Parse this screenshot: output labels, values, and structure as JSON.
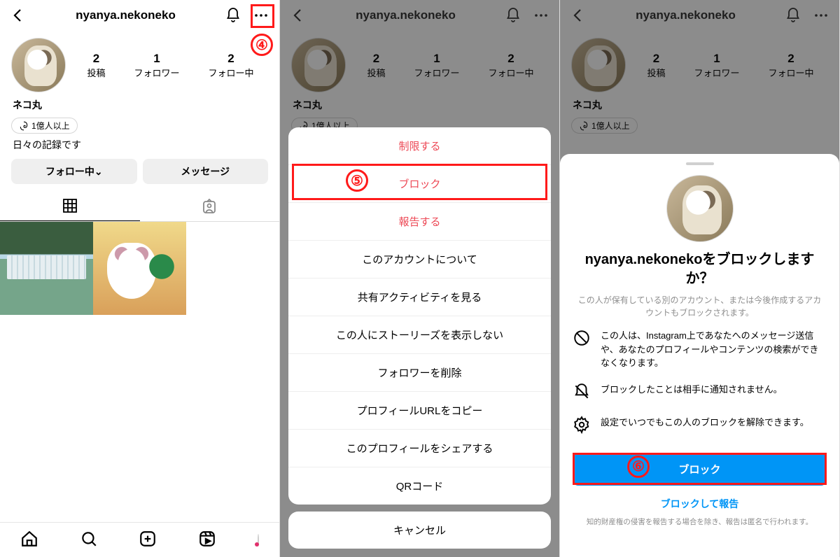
{
  "header": {
    "username": "nyanya.nekoneko"
  },
  "profile": {
    "display_name": "ネコ丸",
    "threads_followers_label": "1億人以上",
    "bio": "日々の記録です"
  },
  "stats": {
    "posts_count": "2",
    "posts_label": "投稿",
    "followers_count": "1",
    "followers_label": "フォロワー",
    "following_count": "2",
    "following_label": "フォロー中"
  },
  "buttons": {
    "following": "フォロー中",
    "message": "メッセージ"
  },
  "action_sheet": {
    "restrict": "制限する",
    "block": "ブロック",
    "report": "報告する",
    "about_account": "このアカウントについて",
    "shared_activity": "共有アクティビティを見る",
    "hide_story": "この人にストーリーズを表示しない",
    "remove_follower": "フォロワーを削除",
    "copy_url": "プロフィールURLをコピー",
    "share_profile": "このプロフィールをシェアする",
    "qr_code": "QRコード",
    "cancel": "キャンセル"
  },
  "block_confirm": {
    "title": "nyanya.nekonekoをブロックしますか？",
    "subtitle": "この人が保有している別のアカウント、または今後作成するアカウントもブロックされます。",
    "info1": "この人は、Instagram上であなたへのメッセージ送信や、あなたのプロフィールやコンテンツの検索ができなくなります。",
    "info2": "ブロックしたことは相手に通知されません。",
    "info3": "設定でいつでもこの人のブロックを解除できます。",
    "block_btn": "ブロック",
    "block_and_report": "ブロックして報告",
    "disclaimer": "知的財産権の侵害を報告する場合を除き、報告は匿名で行われます。"
  },
  "steps": {
    "s4": "④",
    "s5": "⑤",
    "s6": "⑥"
  }
}
